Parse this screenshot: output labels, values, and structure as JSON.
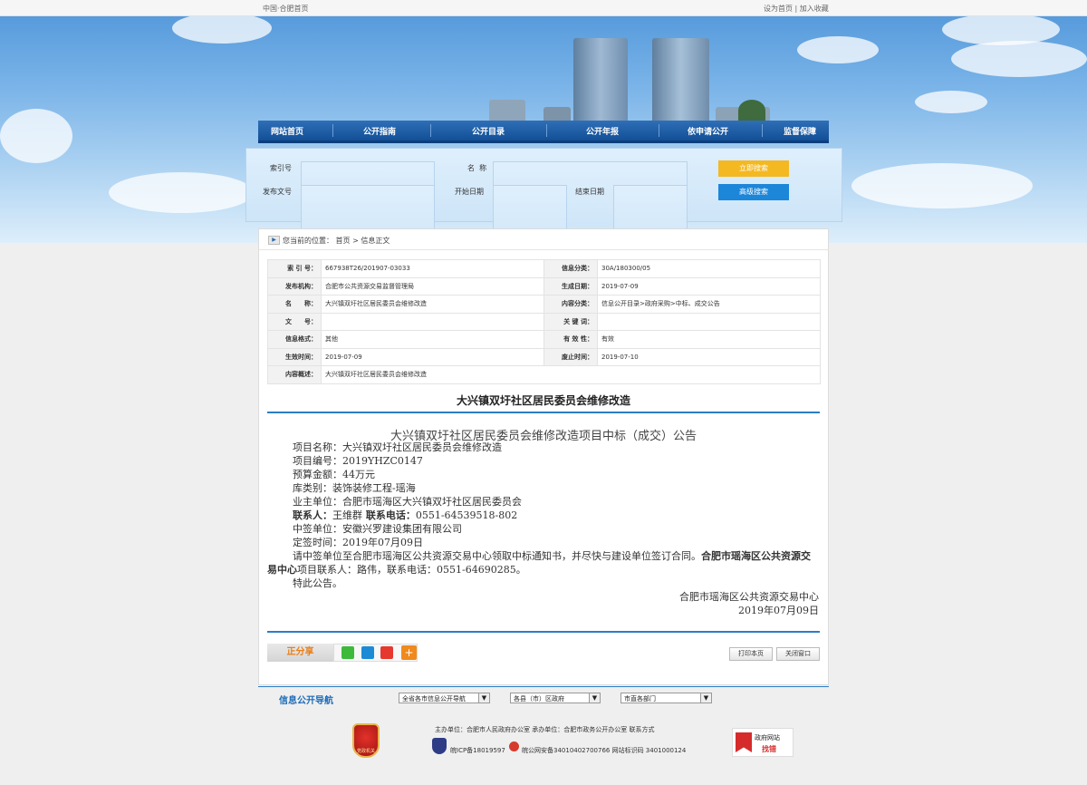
{
  "topbar": {
    "left_link": "中国·合肥首页",
    "right_links": "设为首页 | 加入收藏"
  },
  "nav": {
    "items": [
      "网站首页",
      "公开指南",
      "公开目录",
      "公开年报",
      "依申请公开",
      "监督保障"
    ]
  },
  "search": {
    "labels": {
      "index_no": "索引号",
      "name": "名  称",
      "doc_no": "发布文号",
      "start_date": "开始日期",
      "end_date": "结束日期"
    },
    "search_button": "立即搜索",
    "advanced_button": "高级搜索"
  },
  "breadcrumb": {
    "text": "您当前的位置： 首页 > 信息正文"
  },
  "meta": {
    "rows": [
      {
        "k1": "索 引 号：",
        "v1": "667938T26/201907-03033",
        "k2": "信息分类：",
        "v2": "30A/180300/05"
      },
      {
        "k1": "发布机构：",
        "v1": "合肥市公共资源交易监督管理局",
        "k2": "生成日期：",
        "v2": "2019-07-09"
      },
      {
        "k1": "名　　称：",
        "v1": "大兴镇双圩社区居民委员会维修改造",
        "k2": "内容分类：",
        "v2": "信息公开目录>政府采购>中标、成交公告"
      },
      {
        "k1": "文　　号：",
        "v1": "",
        "k2": "关 键 词：",
        "v2": ""
      },
      {
        "k1": "信息格式：",
        "v1": "其他",
        "k2": "有 效 性：",
        "v2": "有效"
      },
      {
        "k1": "生效时间：",
        "v1": "2019-07-09",
        "k2": "废止时间：",
        "v2": "2019-07-10"
      }
    ],
    "summary_key": "内容概述：",
    "summary_value": "大兴镇双圩社区居民委员会维修改造"
  },
  "article": {
    "title": "大兴镇双圩社区居民委员会维修改造",
    "subtitle": "大兴镇双圩社区居民委员会维修改造项目中标（成交）公告",
    "lines": [
      "项目名称：大兴镇双圩社区居民委员会维修改造",
      "项目编号：2019YHZC0147",
      "预算金额：44万元",
      "库类别：装饰装修工程-瑶海",
      "业主单位：合肥市瑶海区大兴镇双圩社区居民委员会"
    ],
    "contact_label1": "联系人：",
    "contact_name": "王维群",
    "contact_label2": " 联系电话：",
    "contact_phone": "0551-64539518-802",
    "lines2": [
      "中签单位：安徽兴罗建设集团有限公司",
      "定签时间：2019年07月09日"
    ],
    "notice_part1": "请中签单位至合肥市瑶海区公共资源交易中心领取中标通知书，并尽快与建设单位签订合同。",
    "notice_part2_bold": "合肥市瑶海区公共资源交易中心",
    "notice_part3": "项目联系人：路伟，联系电话：0551-64690285。",
    "closing": "特此公告。",
    "signature_org": "合肥市瑶海区公共资源交易中心",
    "signature_date": "2019年07月09日"
  },
  "share": {
    "label": "正分享",
    "plus": "+"
  },
  "actions": {
    "print": "打印本页",
    "close": "关闭窗口"
  },
  "footer": {
    "nav_title": "信息公开导航",
    "selects": [
      "全省各市信息公开导航",
      "各县（市）区政府",
      "市直各部门"
    ],
    "line1": "主办单位：合肥市人民政府办公室  承办单位：合肥市政务公开办公室  联系方式",
    "icp": "皖ICP备18019597",
    "police": "皖公网安备34010402700766  网站标识码 3401000124",
    "badge_right_line1": "政府网站",
    "badge_right_line2": "找错",
    "badge_left": "党政机关"
  },
  "colors": {
    "nav_blue": "#1b5aa3",
    "accent_blue": "#2c7dc5",
    "search_yellow": "#f4b821",
    "advanced_blue": "#1c86d9",
    "share_orange": "#e97f1a"
  }
}
